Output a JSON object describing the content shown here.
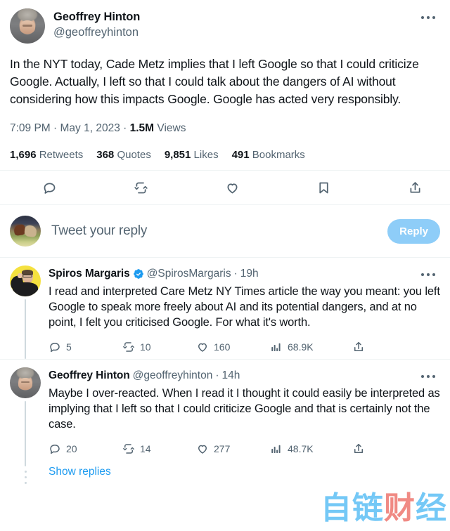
{
  "main_tweet": {
    "display_name": "Geoffrey Hinton",
    "handle": "@geoffreyhinton",
    "avatar_icon": "hinton-portrait-avatar",
    "more_icon": "more-options-icon",
    "text": "In the NYT today, Cade Metz implies that I left Google so that I could criticize Google. Actually, I left so that I could talk about the dangers of AI without considering how this impacts Google. Google has acted very responsibly.",
    "time": "7:09 PM",
    "date": "May 1, 2023",
    "views_count": "1.5M",
    "views_label": "Views",
    "counts": [
      {
        "value": "1,696",
        "label": "Retweets"
      },
      {
        "value": "368",
        "label": "Quotes"
      },
      {
        "value": "9,851",
        "label": "Likes"
      },
      {
        "value": "491",
        "label": "Bookmarks"
      }
    ],
    "actions": [
      {
        "icon": "reply-icon",
        "name": "reply-action"
      },
      {
        "icon": "retweet-icon",
        "name": "retweet-action"
      },
      {
        "icon": "heart-icon",
        "name": "like-action"
      },
      {
        "icon": "bookmark-icon",
        "name": "bookmark-action"
      },
      {
        "icon": "share-icon",
        "name": "share-action"
      }
    ]
  },
  "composer": {
    "avatar_icon": "horses-painting-avatar",
    "placeholder": "Tweet your reply",
    "reply_button_label": "Reply",
    "reply_button_color": "#8ecdf8"
  },
  "replies": [
    {
      "display_name": "Spiros Margaris",
      "verified": true,
      "verified_icon": "verified-badge-icon",
      "handle": "@SpirosMargaris",
      "separator": "·",
      "time": "19h",
      "avatar_icon": "spiros-portrait-avatar",
      "more_icon": "more-options-icon",
      "text": "I read and interpreted Care Metz NY Times article the way you meant: you left Google to speak more freely about AI and its potential dangers, and at no point, I felt you criticised Google. For what it's worth.",
      "metrics": [
        {
          "icon": "reply-icon",
          "value": "5"
        },
        {
          "icon": "retweet-icon",
          "value": "10"
        },
        {
          "icon": "heart-icon",
          "value": "160"
        },
        {
          "icon": "analytics-icon",
          "value": "68.9K"
        },
        {
          "icon": "share-icon",
          "value": ""
        }
      ]
    },
    {
      "display_name": "Geoffrey Hinton",
      "verified": false,
      "handle": "@geoffreyhinton",
      "separator": "·",
      "time": "14h",
      "avatar_icon": "hinton-portrait-avatar",
      "more_icon": "more-options-icon",
      "text": "Maybe I over-reacted. When I read it I thought it could easily be interpreted as implying that I left so that I could criticize Google and that is certainly not the case.",
      "metrics": [
        {
          "icon": "reply-icon",
          "value": "20"
        },
        {
          "icon": "retweet-icon",
          "value": "14"
        },
        {
          "icon": "heart-icon",
          "value": "277"
        },
        {
          "icon": "analytics-icon",
          "value": "48.7K"
        },
        {
          "icon": "share-icon",
          "value": ""
        }
      ],
      "show_replies_label": "Show replies"
    }
  ],
  "watermark": {
    "text_part1": "自",
    "text_part2": "链",
    "text_part3": "财",
    "text_part4": "经",
    "color": "#74c8f6",
    "accent_color": "#f08a84"
  },
  "theme": {
    "background": "#ffffff",
    "text_primary": "#0f1419",
    "text_secondary": "#536471",
    "accent_blue": "#1d9bf0",
    "divider": "#eff3f4",
    "thread_line": "#cfd9de"
  }
}
